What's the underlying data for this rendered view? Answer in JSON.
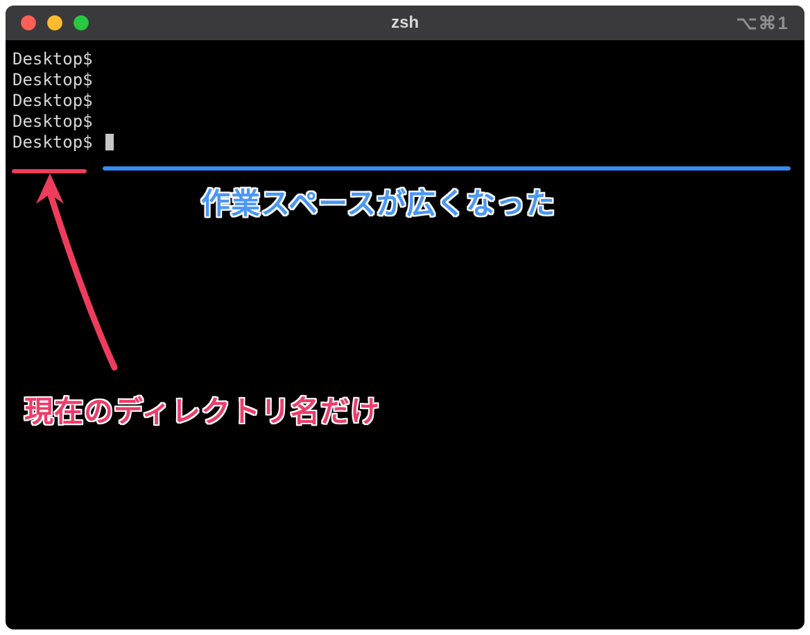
{
  "window": {
    "title": "zsh",
    "shortcut_hint": "⌥⌘1"
  },
  "terminal": {
    "prompts": [
      "Desktop$ ",
      "Desktop$ ",
      "Desktop$ ",
      "Desktop$ ",
      "Desktop$ "
    ]
  },
  "annotations": {
    "blue_text": "作業スペースが広くなった",
    "pink_text": "現在のディレクトリ名だけ",
    "colors": {
      "blue": "#4a97f5",
      "pink": "#ee3d6a",
      "prompt_underline": "#ee3d5c",
      "blue_line": "#3a8af6"
    }
  }
}
